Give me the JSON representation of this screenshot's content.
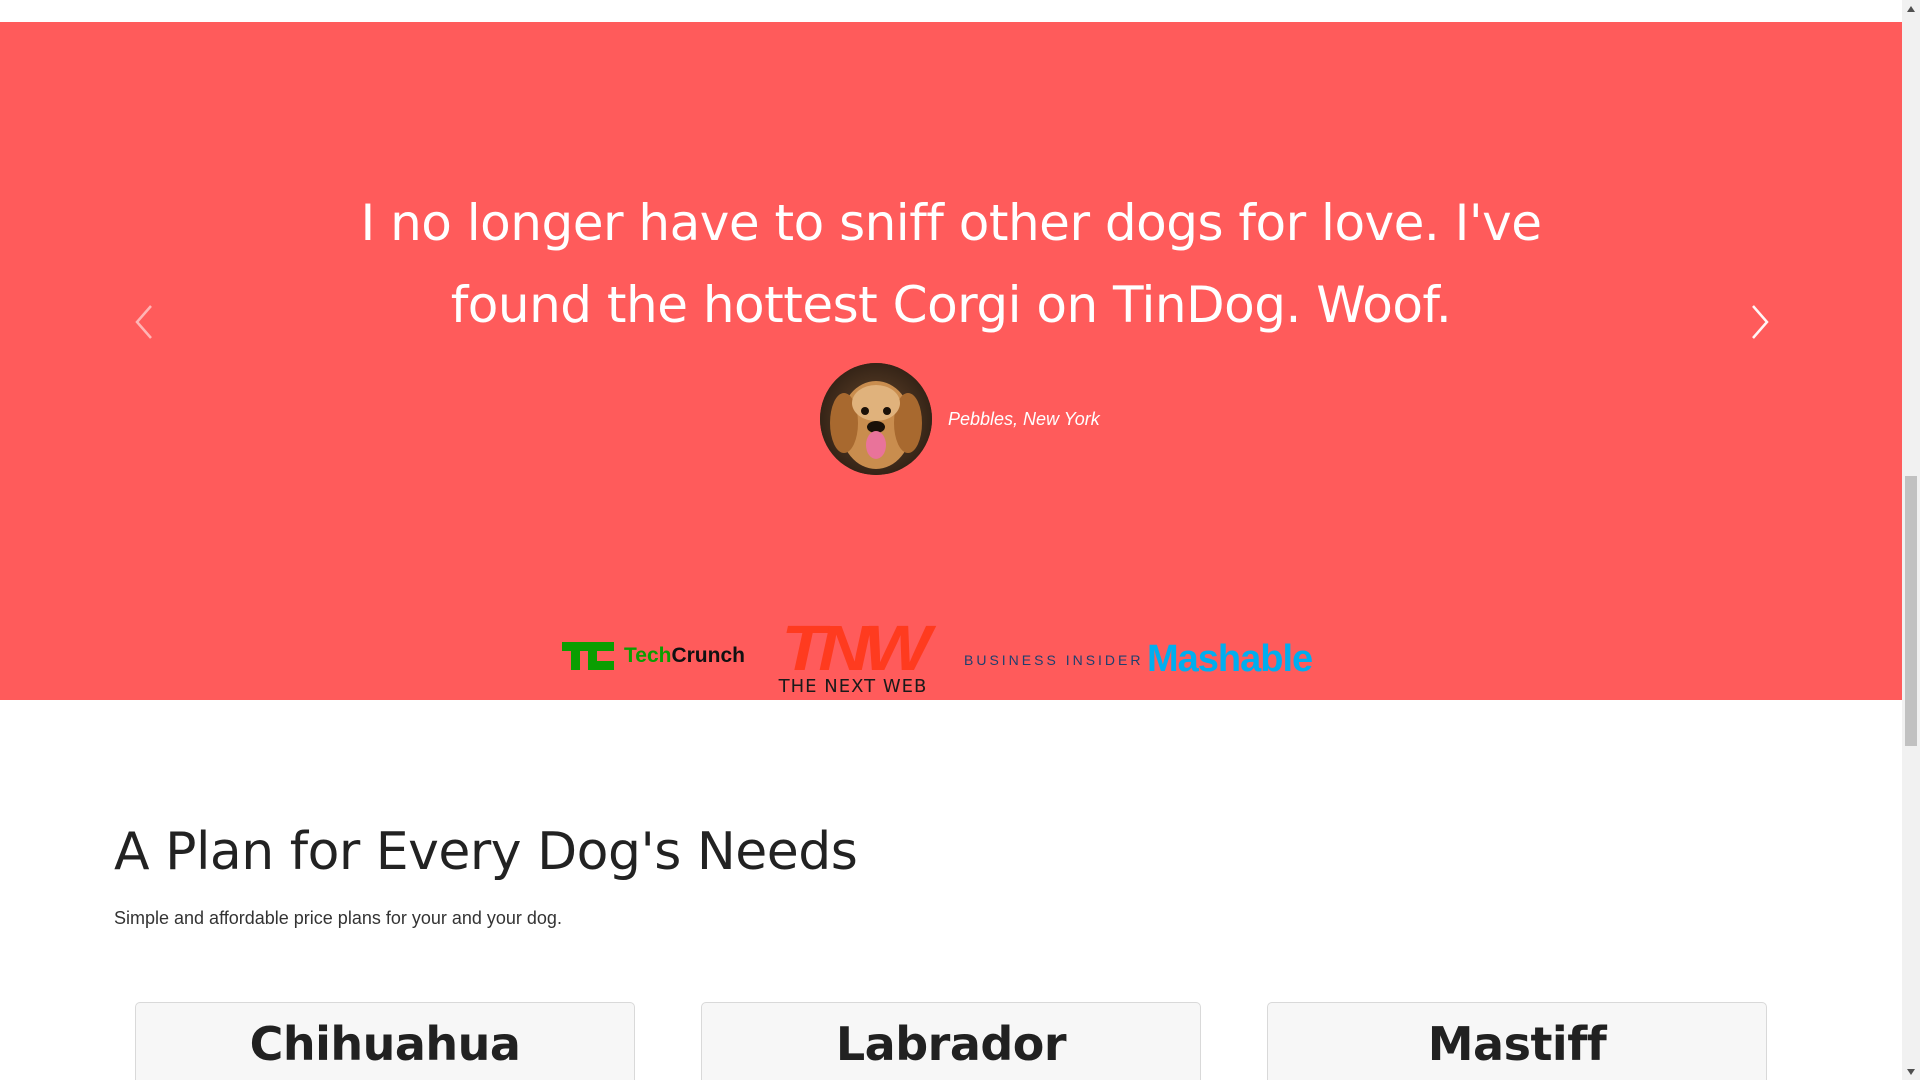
{
  "testimonial": {
    "quote": "I no longer have to sniff other dogs for love. I've found the hottest Corgi on TinDog. Woof.",
    "author": "Pebbles, New York",
    "background_color": "#ff5b5b",
    "prev_icon": "chevron-left-icon",
    "next_icon": "chevron-right-icon"
  },
  "press": {
    "techcrunch": {
      "tech": "Tech",
      "crunch": "Crunch"
    },
    "tnw": {
      "big": "TNW",
      "sub": "THE NEXT WEB"
    },
    "business_insider": "BUSINESS INSIDER",
    "mashable": "Mashable"
  },
  "pricing": {
    "title": "A Plan for Every Dog's Needs",
    "subtitle": "Simple and affordable price plans for your and your dog.",
    "plans": [
      {
        "name": "Chihuahua"
      },
      {
        "name": "Labrador"
      },
      {
        "name": "Mastiff"
      }
    ]
  }
}
